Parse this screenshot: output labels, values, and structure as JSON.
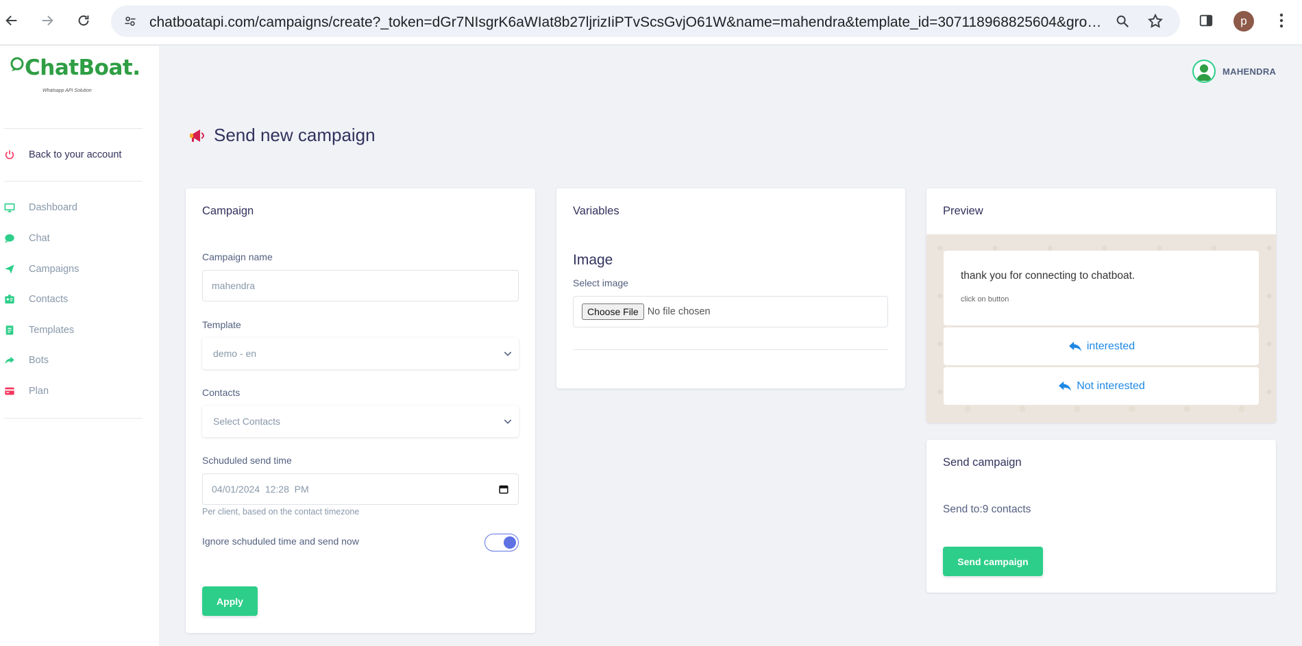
{
  "browser": {
    "url": "chatboatapi.com/campaigns/create?_token=dGr7NIsgrK6aWIat8b27ljrizIiPTvScsGvjO61W&name=mahendra&template_id=307118968825604&grou...",
    "profile_initial": "p"
  },
  "brand": {
    "name": "ChatBoat.",
    "tagline": "Whatsapp API Solution"
  },
  "sidebar": {
    "back_label": "Back to your account",
    "items": [
      {
        "label": "Dashboard",
        "icon": "monitor-icon",
        "color": "#2dce89"
      },
      {
        "label": "Chat",
        "icon": "chat-bubble-icon",
        "color": "#2dce89"
      },
      {
        "label": "Campaigns",
        "icon": "paper-plane-icon",
        "color": "#2dce89"
      },
      {
        "label": "Contacts",
        "icon": "id-card-icon",
        "color": "#2dce89"
      },
      {
        "label": "Templates",
        "icon": "document-icon",
        "color": "#2dce89"
      },
      {
        "label": "Bots",
        "icon": "share-arrow-icon",
        "color": "#2dce89"
      },
      {
        "label": "Plan",
        "icon": "credit-card-icon",
        "color": "#f5365c"
      }
    ]
  },
  "header": {
    "user_name": "MAHENDRA"
  },
  "page": {
    "title": "Send new campaign"
  },
  "campaign_card": {
    "title": "Campaign",
    "name_label": "Campaign name",
    "name_value": "mahendra",
    "template_label": "Template",
    "template_value": "demo - en",
    "contacts_label": "Contacts",
    "contacts_placeholder": "Select Contacts",
    "send_time_label": "Schuduled send time",
    "send_time_value": "04/01/2024  12:28  PM",
    "send_time_help": "Per client, based on the contact timezone",
    "ignore_label": "Ignore schuduled time and send now",
    "ignore_on": true,
    "apply_label": "Apply"
  },
  "variables_card": {
    "title": "Variables",
    "section_title": "Image",
    "select_label": "Select image",
    "choose_button": "Choose File",
    "no_file": "No file chosen"
  },
  "preview_card": {
    "title": "Preview",
    "message_body": "thank you for connecting to chatboat.",
    "message_footer": "click on button",
    "buttons": [
      "interested",
      "Not interested"
    ]
  },
  "send_card": {
    "title": "Send campaign",
    "send_to_text": "Send to:9 contacts",
    "send_button": "Send campaign"
  },
  "colors": {
    "accent_green": "#2dce89",
    "brand_green": "#2f9e44",
    "toggle_blue": "#5e72e4",
    "link_blue": "#1e88e5"
  }
}
